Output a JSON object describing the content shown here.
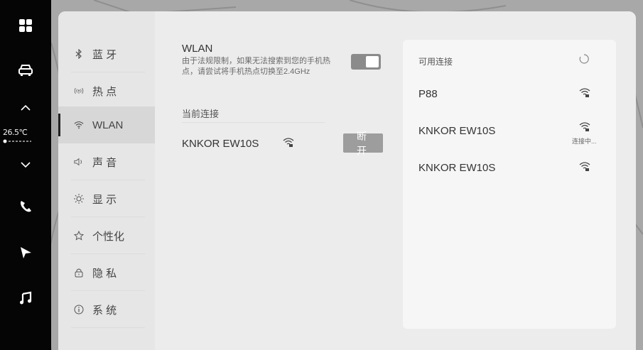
{
  "dock": {
    "temperature": "26.5℃",
    "icons": [
      "grid-icon",
      "car-icon",
      "chevron-up-icon",
      "chevron-down-icon",
      "phone-icon",
      "navigation-icon",
      "music-icon"
    ]
  },
  "nav": {
    "items": [
      {
        "label": "蓝 牙",
        "icon": "bluetooth-icon",
        "active": false
      },
      {
        "label": "热 点",
        "icon": "hotspot-icon",
        "active": false
      },
      {
        "label": "WLAN",
        "icon": "wifi-icon",
        "active": true
      },
      {
        "label": "声 音",
        "icon": "speaker-icon",
        "active": false
      },
      {
        "label": "显 示",
        "icon": "brightness-icon",
        "active": false
      },
      {
        "label": "个性化",
        "icon": "personalize-icon",
        "active": false
      },
      {
        "label": "隐 私",
        "icon": "lock-icon",
        "active": false
      },
      {
        "label": "系 统",
        "icon": "info-icon",
        "active": false
      }
    ]
  },
  "wlan": {
    "title": "WLAN",
    "note": "由于法规限制，如果无法搜索到您的手机热点，请尝试将手机热点切换至2.4GHz",
    "enabled": true,
    "current_section": "当前连接",
    "current_network": "KNKOR EW10S",
    "disconnect_label": "断 开"
  },
  "available": {
    "title": "可用连接",
    "networks": [
      {
        "name": "P88",
        "status": ""
      },
      {
        "name": "KNKOR EW10S",
        "status": "连接中..."
      },
      {
        "name": "KNKOR EW10S",
        "status": ""
      }
    ]
  }
}
